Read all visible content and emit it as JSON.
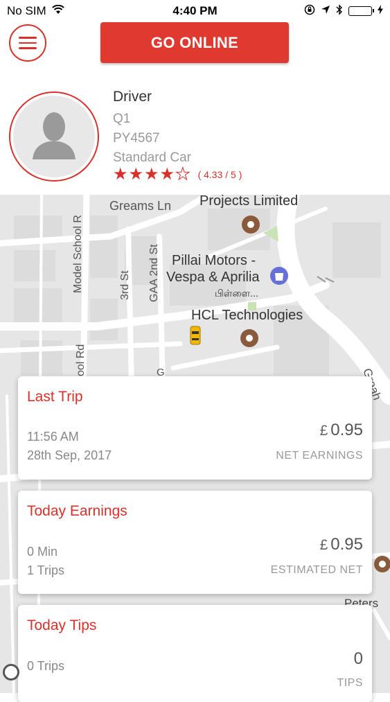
{
  "status_bar": {
    "carrier": "No SIM",
    "time": "4:40 PM"
  },
  "header": {
    "go_online_label": "GO ONLINE"
  },
  "driver": {
    "name": "Driver",
    "code": "Q1",
    "plate": "PY4567",
    "vehicle": "Standard Car",
    "rating_text": "( 4.33 / 5 )",
    "rating_value": 4.33,
    "rating_max": 5
  },
  "map": {
    "labels": {
      "greams_ln": "Greams Ln",
      "projects_limited": "Projects Limited",
      "pillai_line1": "Pillai Motors -",
      "pillai_line2": "Vespa & Aprilia",
      "pillai_tamil": "பிள்ளை...",
      "hcl": "HCL Technologies",
      "model_school_rd": "Model School R",
      "third_st": "3rd St",
      "gaa_2nd_st": "GAA 2nd St",
      "ol_rd": "ool Rd",
      "g_partial": "G",
      "greams_partial": "Greah",
      "peters": "Peters"
    }
  },
  "cards": {
    "last_trip": {
      "title": "Last Trip",
      "time": "11:56 AM",
      "date": "28th Sep, 2017",
      "currency": "£",
      "amount": "0.95",
      "caption": "NET EARNINGS"
    },
    "today_earnings": {
      "title": "Today Earnings",
      "minutes": "0 Min",
      "trips": "1 Trips",
      "currency": "£",
      "amount": "0.95",
      "caption": "ESTIMATED NET"
    },
    "today_tips": {
      "title": "Today Tips",
      "trips": "0 Trips",
      "amount": "0",
      "caption": "TIPS"
    }
  },
  "colors": {
    "accent": "#d9302b",
    "button": "#e03a30",
    "map_bg": "#e6e6e6"
  }
}
